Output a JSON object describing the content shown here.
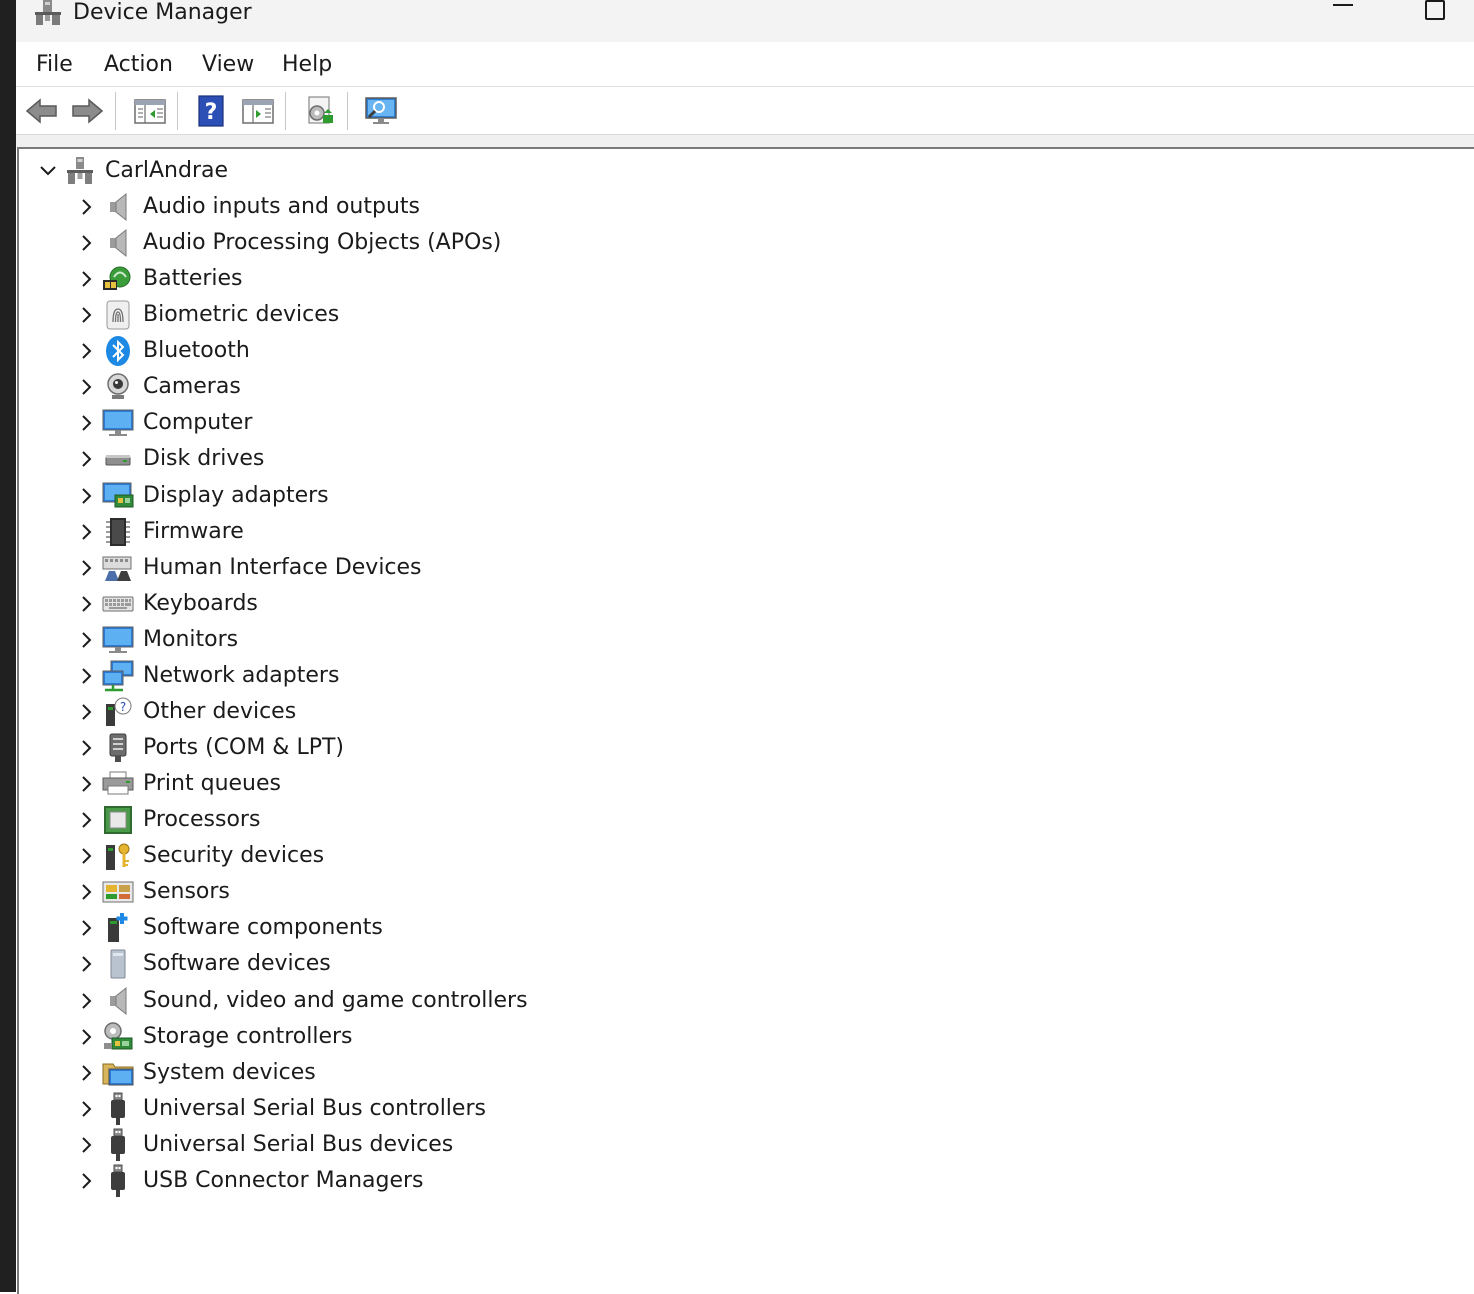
{
  "window": {
    "title": "Device Manager",
    "icon": "device-manager-icon",
    "controls": [
      "minimize-icon",
      "maximize-icon"
    ]
  },
  "menu": {
    "file": "File",
    "action": "Action",
    "view": "View",
    "help": "Help"
  },
  "toolbar": {
    "buttons": [
      "back-arrow-icon",
      "forward-arrow-icon",
      "show-hide-console-tree-icon",
      "help-icon",
      "properties-icon",
      "update-driver-icon",
      "scan-hardware-changes-icon"
    ]
  },
  "tree": {
    "root": {
      "label": "CarlAndrae",
      "expanded": true,
      "icon": "computer-tower-icon"
    },
    "categories": [
      {
        "label": "Audio inputs and outputs",
        "icon": "speaker-icon"
      },
      {
        "label": "Audio Processing Objects (APOs)",
        "icon": "speaker-icon"
      },
      {
        "label": "Batteries",
        "icon": "battery-icon"
      },
      {
        "label": "Biometric devices",
        "icon": "fingerprint-icon"
      },
      {
        "label": "Bluetooth",
        "icon": "bluetooth-icon"
      },
      {
        "label": "Cameras",
        "icon": "camera-icon"
      },
      {
        "label": "Computer",
        "icon": "monitor-icon"
      },
      {
        "label": "Disk drives",
        "icon": "disk-drive-icon"
      },
      {
        "label": "Display adapters",
        "icon": "display-adapter-icon"
      },
      {
        "label": "Firmware",
        "icon": "chip-icon"
      },
      {
        "label": "Human Interface Devices",
        "icon": "hid-icon"
      },
      {
        "label": "Keyboards",
        "icon": "keyboard-icon"
      },
      {
        "label": "Monitors",
        "icon": "monitor-icon"
      },
      {
        "label": "Network adapters",
        "icon": "network-icon"
      },
      {
        "label": "Other devices",
        "icon": "unknown-device-icon"
      },
      {
        "label": "Ports (COM & LPT)",
        "icon": "port-icon"
      },
      {
        "label": "Print queues",
        "icon": "printer-icon"
      },
      {
        "label": "Processors",
        "icon": "processor-icon"
      },
      {
        "label": "Security devices",
        "icon": "security-key-icon"
      },
      {
        "label": "Sensors",
        "icon": "sensor-icon"
      },
      {
        "label": "Software components",
        "icon": "software-component-icon"
      },
      {
        "label": "Software devices",
        "icon": "software-device-icon"
      },
      {
        "label": "Sound, video and game controllers",
        "icon": "speaker-icon"
      },
      {
        "label": "Storage controllers",
        "icon": "storage-controller-icon"
      },
      {
        "label": "System devices",
        "icon": "system-folder-icon"
      },
      {
        "label": "Universal Serial Bus controllers",
        "icon": "usb-plug-icon"
      },
      {
        "label": "Universal Serial Bus devices",
        "icon": "usb-plug-icon"
      },
      {
        "label": "USB Connector Managers",
        "icon": "usb-plug-icon"
      }
    ]
  }
}
